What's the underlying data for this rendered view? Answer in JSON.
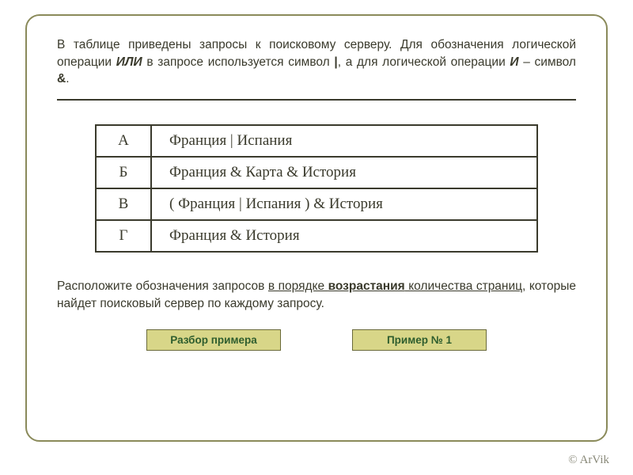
{
  "intro": {
    "line1": "В таблице приведены запросы к поисковому серверу. Для обозначения логической операции ",
    "or": "ИЛИ",
    "line2": " в запросе используется символ ",
    "pipe": "|",
    "line3": ", а для логической операции ",
    "and": "И",
    "line4": " – символ ",
    "amp": "&",
    "period": "."
  },
  "table": {
    "rows": [
      {
        "letter": "А",
        "query": "Франция  |  Испания"
      },
      {
        "letter": "Б",
        "query": "Франция  &  Карта  &  История"
      },
      {
        "letter": "В",
        "query": "( Франция  |  Испания )  &  История"
      },
      {
        "letter": "Г",
        "query": "Франция  &  История"
      }
    ]
  },
  "instruction": {
    "part1": "Расположите обозначения запросов ",
    "u1": "в порядке ",
    "u1b": "возрастания",
    "u2": " количества страниц",
    "part2": ", которые найдет поисковый сервер по каждому запросу."
  },
  "buttons": {
    "review": "Разбор примера",
    "example1": "Пример № 1"
  },
  "copyright": "© ArVik"
}
